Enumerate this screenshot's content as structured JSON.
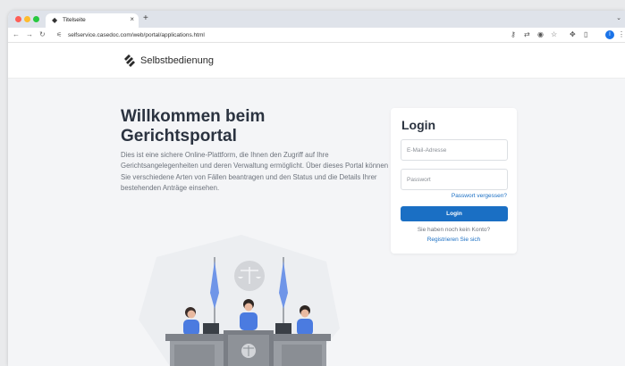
{
  "browser": {
    "tab_title": "Titelseite",
    "tab_close": "×",
    "new_tab": "+",
    "url": "selfservice.casedoc.com/web/portal/applications.html",
    "profile_initial": "I"
  },
  "header": {
    "brand": "Selbstbedienung"
  },
  "hero": {
    "title": "Willkommen beim Gerichtsportal",
    "description": "Dies ist eine sichere Online-Plattform, die Ihnen den Zugriff auf Ihre Gerichtsangelegenheiten und deren Verwaltung ermöglicht. Über dieses Portal können Sie verschiedene Arten von Fällen beantragen und den Status und die Details Ihrer bestehenden Anträge einsehen."
  },
  "login": {
    "title": "Login",
    "email_placeholder": "E-Mail-Adresse",
    "password_placeholder": "Passwort",
    "forgot_password": "Passwort vergessen?",
    "submit_label": "Login",
    "no_account": "Sie haben noch kein Konto?",
    "register": "Registrieren Sie sich"
  },
  "icons": {
    "tab_favicon": "logo-icon",
    "back": "arrow-left-icon",
    "forward": "arrow-right-icon",
    "reload": "reload-icon",
    "site_info": "tune-icon",
    "password_manager": "key-icon",
    "translate": "translate-icon",
    "eye": "eye-icon",
    "bookmark": "star-icon",
    "extensions": "puzzle-icon",
    "sidebar": "sidebar-icon",
    "menu": "more-vert-icon"
  },
  "colors": {
    "accent": "#1a6fc4",
    "title": "#2b3340",
    "page_bg": "#f4f5f7",
    "illustration_blue": "#4b7be0",
    "desk_gray": "#8a8e94"
  }
}
